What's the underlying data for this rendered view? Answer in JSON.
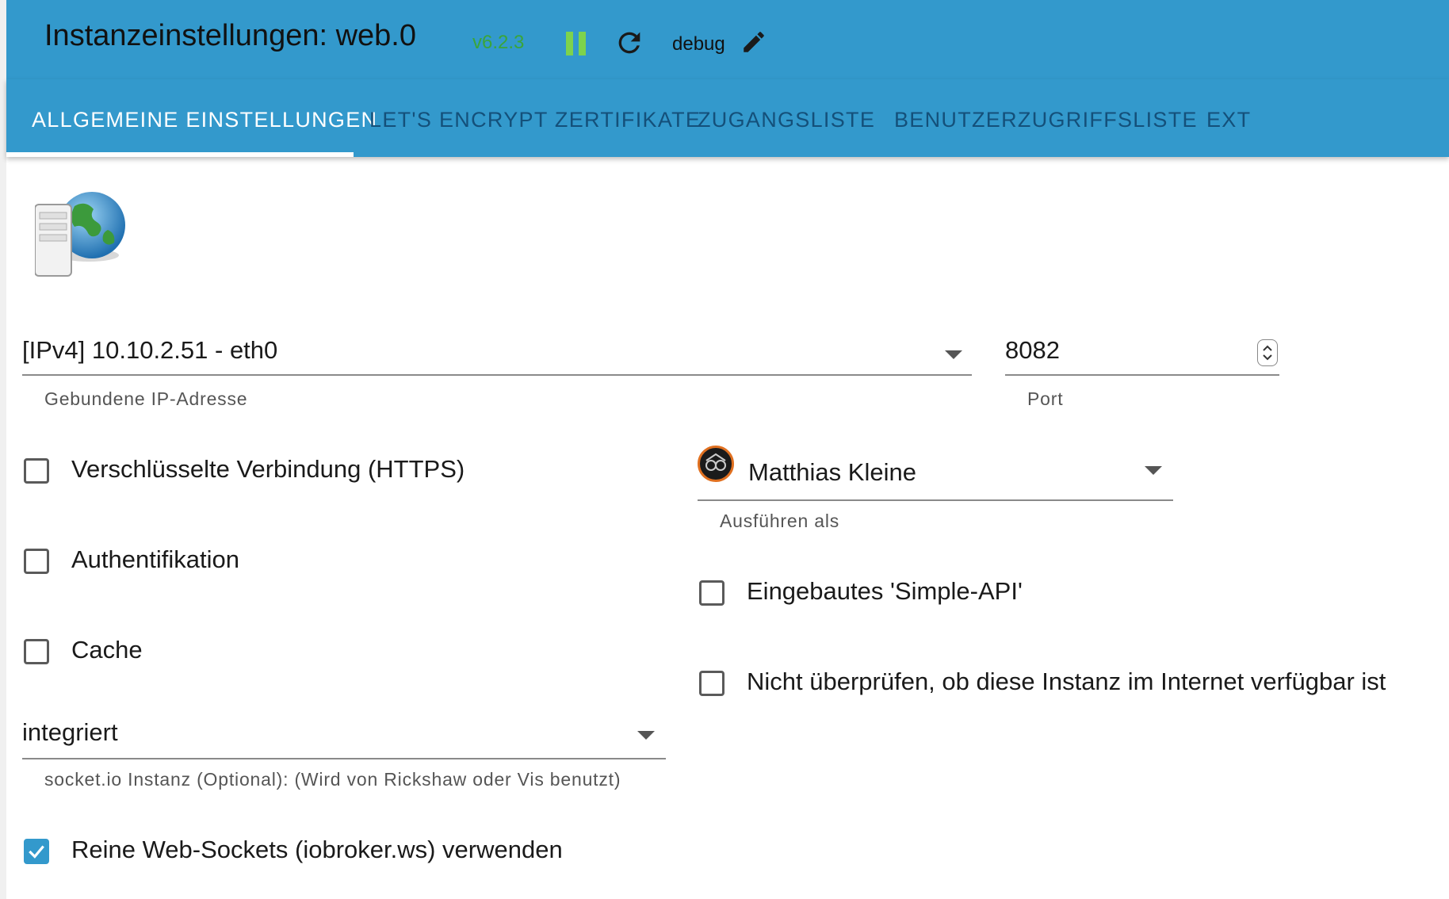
{
  "header": {
    "title": "Instanzeinstellungen: web.0",
    "version": "v6.2.3",
    "log_level": "debug",
    "colors": {
      "bar": "#3399cc",
      "version": "#3aa53a",
      "running": "#7dd34d"
    },
    "icons": [
      "pause-icon",
      "reload-icon",
      "edit-icon"
    ]
  },
  "tabs": [
    {
      "label": "ALLGEMEINE EINSTELLUNGEN",
      "active": true
    },
    {
      "label": "LET'S ENCRYPT ZERTIFIKATE"
    },
    {
      "label": "ZUGANGSLISTE"
    },
    {
      "label": "BENUTZERZUGRIFFSLISTE"
    },
    {
      "label": "EXT"
    }
  ],
  "form": {
    "bind_ip": {
      "value": "[IPv4] 10.10.2.51 - eth0",
      "helper": "Gebundene IP-Adresse"
    },
    "port": {
      "value": "8082",
      "helper": "Port"
    },
    "https": {
      "label": "Verschlüsselte Verbindung (HTTPS)",
      "checked": false
    },
    "auth": {
      "label": "Authentifikation",
      "checked": false
    },
    "cache": {
      "label": "Cache",
      "checked": false
    },
    "socketio": {
      "value": "integriert",
      "helper": "socket.io Instanz (Optional): (Wird von Rickshaw oder Vis benutzt)"
    },
    "pure_ws": {
      "label": "Reine Web-Sockets (iobroker.ws) verwenden",
      "checked": true
    },
    "run_as": {
      "value": "Matthias Kleine",
      "helper": "Ausführen als"
    },
    "simple_api": {
      "label": "Eingebautes 'Simple-API'",
      "checked": false
    },
    "no_check": {
      "label": "Nicht überprüfen, ob diese Instanz im Internet verfügbar ist",
      "checked": false
    }
  }
}
